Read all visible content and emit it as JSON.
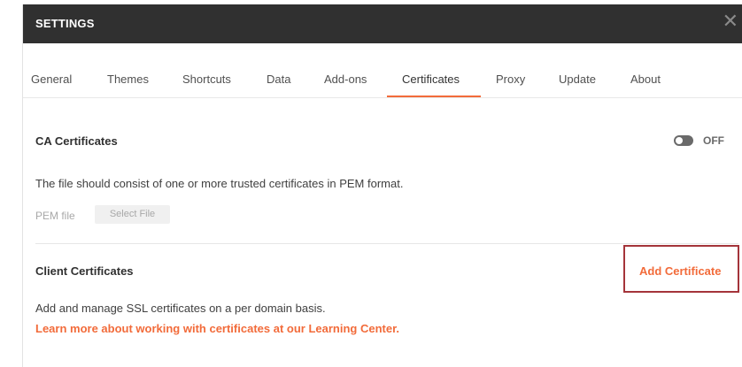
{
  "window": {
    "title": "SETTINGS",
    "close_glyph": "✕"
  },
  "tabs": [
    {
      "label": "General"
    },
    {
      "label": "Themes"
    },
    {
      "label": "Shortcuts"
    },
    {
      "label": "Data"
    },
    {
      "label": "Add-ons"
    },
    {
      "label": "Certificates",
      "active": true
    },
    {
      "label": "Proxy"
    },
    {
      "label": "Update"
    },
    {
      "label": "About"
    }
  ],
  "ca": {
    "title": "CA Certificates",
    "toggle_state": "OFF",
    "description": "The file should consist of one or more trusted certificates in PEM format.",
    "pem_label": "PEM file",
    "select_file_label": "Select File"
  },
  "client": {
    "title": "Client Certificates",
    "add_label": "Add Certificate",
    "description": "Add and manage SSL certificates on a per domain basis.",
    "learn_link": "Learn more about working with certificates at our Learning Center."
  },
  "colors": {
    "accent": "#f26b3a",
    "titlebar": "#303030",
    "highlight_box": "#a4343a"
  }
}
